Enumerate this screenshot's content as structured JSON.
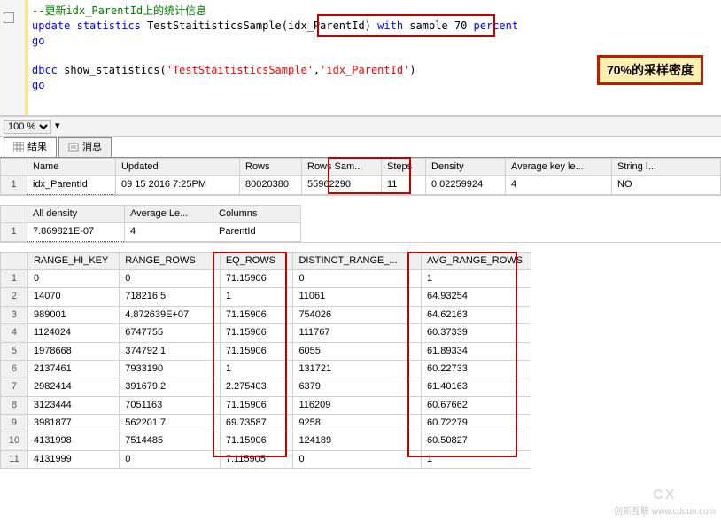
{
  "code": {
    "comment": "--更新idx_ParentId上的统计信息",
    "l2_a": "update",
    "l2_b": "statistics",
    "l2_c": " TestStaitisticsSample(idx_ParentId) ",
    "l2_d": "with",
    "l2_e": " sample ",
    "l2_f": "70",
    "l2_g": " percent",
    "l3": "go",
    "l5_a": "dbcc",
    "l5_b": " show_statistics(",
    "l5_c": "'TestStaitisticsSample'",
    "l5_d": ",",
    "l5_e": "'idx_ParentId'",
    "l5_f": ")",
    "l6": "go"
  },
  "zoom": "100 %",
  "tabs": {
    "results": "结果",
    "messages": "消息"
  },
  "percent_label": "70%的采样密度",
  "table1": {
    "headers": [
      "",
      "Name",
      "Updated",
      "Rows",
      "Rows Sam...",
      "Steps",
      "Density",
      "Average key le...",
      "String I..."
    ],
    "rownum": "1",
    "cells": [
      "idx_ParentId",
      "09 15 2016  7:25PM",
      "80020380",
      "55962290",
      "11",
      "0.02259924",
      "4",
      "NO"
    ]
  },
  "table2": {
    "headers": [
      "",
      "All density",
      "Average Le...",
      "Columns"
    ],
    "rownum": "1",
    "cells": [
      "7.869821E-07",
      "4",
      "ParentId"
    ]
  },
  "table3": {
    "headers": [
      "",
      "RANGE_HI_KEY",
      "RANGE_ROWS",
      "EQ_ROWS",
      "DISTINCT_RANGE_...",
      "AVG_RANGE_ROWS"
    ],
    "rows": [
      [
        "1",
        "0",
        "0",
        "71.15906",
        "0",
        "1"
      ],
      [
        "2",
        "14070",
        "718216.5",
        "1",
        "11061",
        "64.93254"
      ],
      [
        "3",
        "989001",
        "4.872639E+07",
        "71.15906",
        "754026",
        "64.62163"
      ],
      [
        "4",
        "1124024",
        "6747755",
        "71.15906",
        "111767",
        "60.37339"
      ],
      [
        "5",
        "1978668",
        "374792.1",
        "71.15906",
        "6055",
        "61.89334"
      ],
      [
        "6",
        "2137461",
        "7933190",
        "1",
        "131721",
        "60.22733"
      ],
      [
        "7",
        "2982414",
        "391679.2",
        "2.275403",
        "6379",
        "61.40163"
      ],
      [
        "8",
        "3123444",
        "7051163",
        "71.15906",
        "116209",
        "60.67662"
      ],
      [
        "9",
        "3981877",
        "562201.7",
        "69.73587",
        "9258",
        "60.72279"
      ],
      [
        "10",
        "4131998",
        "7514485",
        "71.15906",
        "124189",
        "60.50827"
      ],
      [
        "11",
        "4131999",
        "0",
        "7.115905",
        "0",
        "1"
      ]
    ]
  },
  "watermark": {
    "brand": "CX",
    "text": "创新互联 www.cdcun.com"
  }
}
